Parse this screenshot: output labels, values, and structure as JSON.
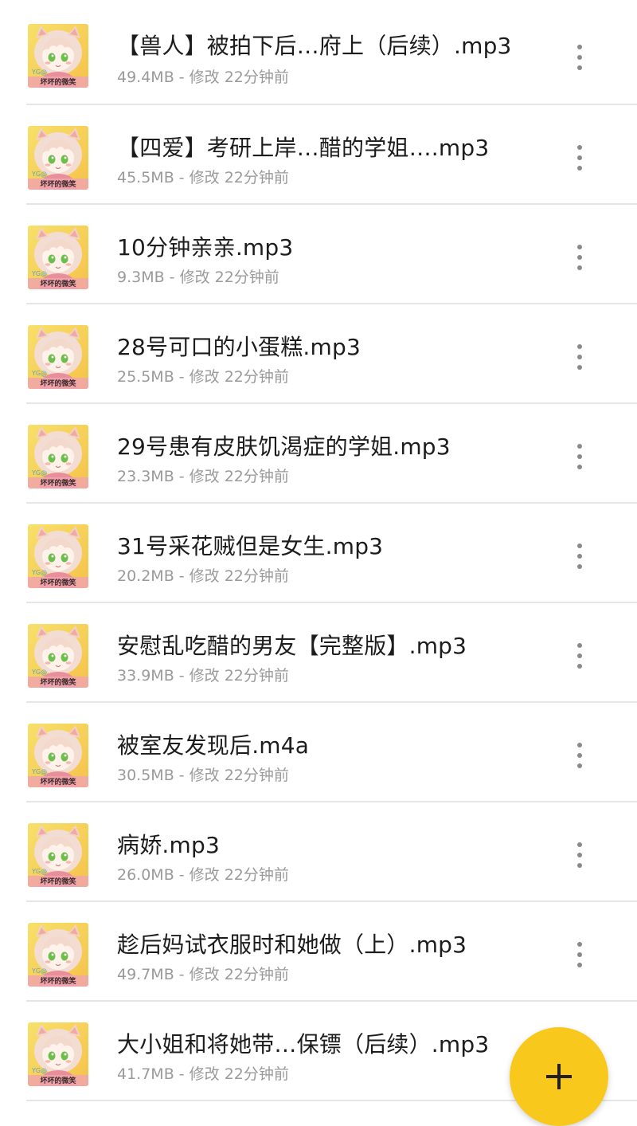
{
  "accent_color": "#f8c81d",
  "thumbnail": {
    "icon": "anime-girl-thumbnail-icon",
    "caption": "坏坏的微笑",
    "watermark": "YG@"
  },
  "files": [
    {
      "name": "【兽人】被拍下后…府上（后续）.mp3",
      "meta": "49.4MB - 修改 22分钟前"
    },
    {
      "name": "【四爱】考研上岸…醋的学姐….mp3",
      "meta": "45.5MB - 修改 22分钟前"
    },
    {
      "name": "10分钟亲亲.mp3",
      "meta": "9.3MB - 修改 22分钟前"
    },
    {
      "name": "28号可口的小蛋糕.mp3",
      "meta": "25.5MB - 修改 22分钟前"
    },
    {
      "name": "29号患有皮肤饥渴症的学姐.mp3",
      "meta": "23.3MB - 修改 22分钟前"
    },
    {
      "name": "31号采花贼但是女生.mp3",
      "meta": "20.2MB - 修改 22分钟前"
    },
    {
      "name": "安慰乱吃醋的男友【完整版】.mp3",
      "meta": "33.9MB - 修改 22分钟前"
    },
    {
      "name": "被室友发现后.m4a",
      "meta": "30.5MB - 修改 22分钟前"
    },
    {
      "name": "病娇.mp3",
      "meta": "26.0MB - 修改 22分钟前"
    },
    {
      "name": "趁后妈试衣服时和她做（上）.mp3",
      "meta": "49.7MB - 修改 22分钟前"
    },
    {
      "name": "大小姐和将她带…保镖（后续）.mp3",
      "meta": "41.7MB - 修改 22分钟前"
    }
  ],
  "fab": {
    "icon": "plus-icon"
  }
}
